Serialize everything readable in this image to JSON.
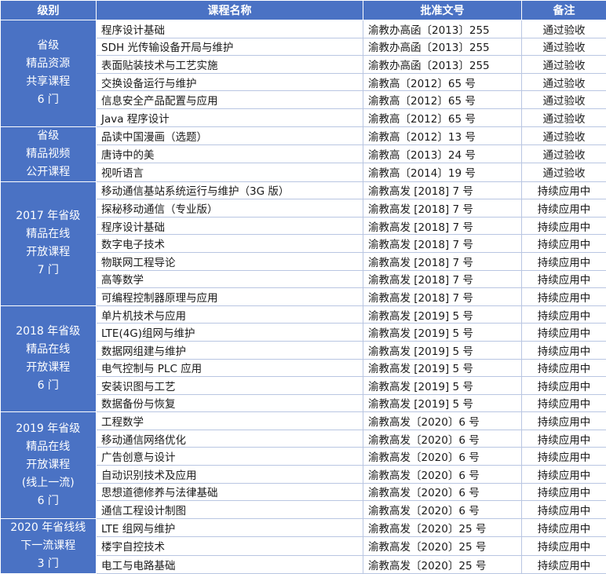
{
  "headers": [
    "级别",
    "课程名称",
    "批准文号",
    "备注"
  ],
  "groups": [
    {
      "level_lines": [
        "省级",
        "精品资源",
        "共享课程",
        "6 门"
      ],
      "rows": [
        {
          "course": "程序设计基础",
          "doc": "渝教办高函〔2013〕255",
          "note": "通过验收"
        },
        {
          "course": "SDH 光传输设备开局与维护",
          "doc": "渝教办高函〔2013〕255",
          "note": "通过验收"
        },
        {
          "course": "表面贴装技术与工艺实施",
          "doc": "渝教办高函〔2013〕255",
          "note": "通过验收"
        },
        {
          "course": "交换设备运行与维护",
          "doc": "渝教高〔2012〕65 号",
          "note": "通过验收"
        },
        {
          "course": "信息安全产品配置与应用",
          "doc": "渝教高〔2012〕65 号",
          "note": "通过验收"
        },
        {
          "course": "Java 程序设计",
          "doc": "渝教高〔2012〕65 号",
          "note": "通过验收"
        }
      ]
    },
    {
      "level_lines": [
        "省级",
        "精品视频",
        "公开课程"
      ],
      "rows": [
        {
          "course": "品读中国漫画（选题）",
          "doc": "渝教高〔2012〕13 号",
          "note": "通过验收"
        },
        {
          "course": "唐诗中的美",
          "doc": "渝教高〔2013〕24 号",
          "note": "通过验收"
        },
        {
          "course": "视听语言",
          "doc": "渝教高〔2014〕19 号",
          "note": "通过验收"
        }
      ]
    },
    {
      "level_lines": [
        "2017 年省级",
        "精品在线",
        "开放课程",
        "7 门"
      ],
      "rows": [
        {
          "course": "移动通信基站系统运行与维护（3G 版）",
          "doc": "渝教高发 [2018] 7 号",
          "note": "持续应用中"
        },
        {
          "course": "探秘移动通信（专业版）",
          "doc": "渝教高发 [2018] 7 号",
          "note": "持续应用中"
        },
        {
          "course": "程序设计基础",
          "doc": "渝教高发 [2018] 7 号",
          "note": "持续应用中"
        },
        {
          "course": "数字电子技术",
          "doc": "渝教高发 [2018] 7 号",
          "note": "持续应用中"
        },
        {
          "course": "物联网工程导论",
          "doc": "渝教高发 [2018] 7 号",
          "note": "持续应用中"
        },
        {
          "course": "高等数学",
          "doc": "渝教高发 [2018] 7 号",
          "note": "持续应用中"
        },
        {
          "course": "可编程控制器原理与应用",
          "doc": "渝教高发 [2018] 7 号",
          "note": "持续应用中"
        }
      ]
    },
    {
      "level_lines": [
        "2018 年省级",
        "精品在线",
        "开放课程",
        "6 门"
      ],
      "rows": [
        {
          "course": "单片机技术与应用",
          "doc": "渝教高发 [2019] 5 号",
          "note": "持续应用中"
        },
        {
          "course": "LTE(4G)组网与维护",
          "doc": "渝教高发 [2019] 5 号",
          "note": "持续应用中"
        },
        {
          "course": "数据网组建与维护",
          "doc": "渝教高发 [2019] 5 号",
          "note": "持续应用中"
        },
        {
          "course": "电气控制与 PLC 应用",
          "doc": "渝教高发 [2019] 5 号",
          "note": "持续应用中"
        },
        {
          "course": "安装识图与工艺",
          "doc": "渝教高发 [2019] 5 号",
          "note": "持续应用中"
        },
        {
          "course": "数据备份与恢复",
          "doc": "渝教高发 [2019] 5 号",
          "note": "持续应用中"
        }
      ]
    },
    {
      "level_lines": [
        "2019 年省级",
        "精品在线",
        "开放课程",
        "(线上一流)",
        "6 门"
      ],
      "rows": [
        {
          "course": "工程数学",
          "doc": "渝教高发〔2020〕6 号",
          "note": "持续应用中"
        },
        {
          "course": "移动通信网络优化",
          "doc": "渝教高发〔2020〕6 号",
          "note": "持续应用中"
        },
        {
          "course": "广告创意与设计",
          "doc": "渝教高发〔2020〕6 号",
          "note": "持续应用中"
        },
        {
          "course": "自动识别技术及应用",
          "doc": "渝教高发〔2020〕6 号",
          "note": "持续应用中"
        },
        {
          "course": "思想道德修养与法律基础",
          "doc": "渝教高发〔2020〕6 号",
          "note": "持续应用中"
        },
        {
          "course": "通信工程设计制图",
          "doc": "渝教高发〔2020〕6 号",
          "note": "持续应用中"
        }
      ]
    },
    {
      "level_lines": [
        "2020 年省线线",
        "下一流课程",
        "3 门"
      ],
      "rows": [
        {
          "course": "LTE 组网与维护",
          "doc": "渝教高发〔2020〕25 号",
          "note": "持续应用中"
        },
        {
          "course": "楼宇自控技术",
          "doc": "渝教高发〔2020〕25 号",
          "note": "持续应用中"
        },
        {
          "course": "电工与电路基础",
          "doc": "渝教高发〔2020〕25 号",
          "note": "持续应用中"
        }
      ]
    }
  ]
}
